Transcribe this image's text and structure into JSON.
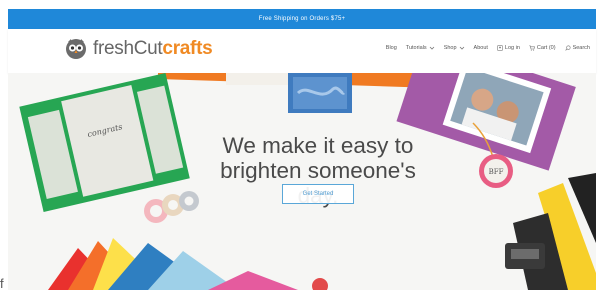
{
  "promo": {
    "text": "Free Shipping on Orders $75+"
  },
  "brand": {
    "name_prefix": "freshCut",
    "name_accent": "crafts",
    "accent_color": "#f08a24",
    "promo_color": "#1f88d9"
  },
  "nav": {
    "items": [
      {
        "label": "Blog",
        "has_dropdown": false
      },
      {
        "label": "Tutorials",
        "has_dropdown": true
      },
      {
        "label": "Shop",
        "has_dropdown": true
      },
      {
        "label": "About",
        "has_dropdown": false
      }
    ],
    "login": {
      "label": "Log in",
      "icon": "user-icon"
    },
    "cart": {
      "label": "Cart (0)",
      "icon": "cart-icon"
    },
    "search": {
      "label": "Search",
      "icon": "search-icon"
    }
  },
  "hero": {
    "headline_lines": [
      "We make it easy to",
      "brighten someone's",
      "day."
    ],
    "cta_label": "Get Started",
    "card_script": "congrats",
    "tag_text": "BFF"
  },
  "stray_text": "f"
}
